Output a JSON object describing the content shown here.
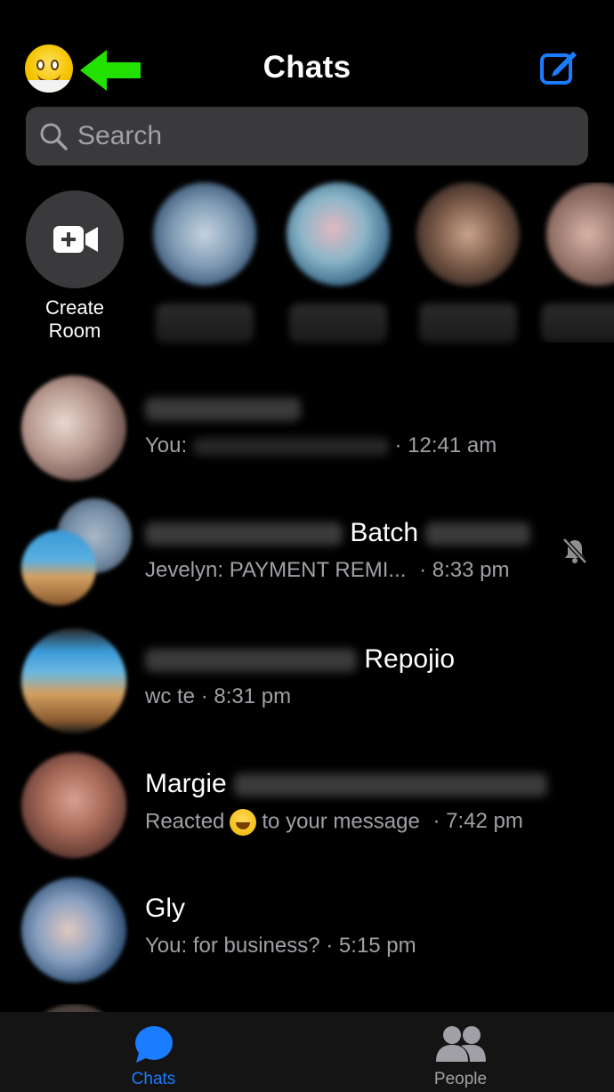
{
  "header": {
    "title": "Chats",
    "arrow_color": "#22e000",
    "accent_color": "#1a7cff"
  },
  "search": {
    "placeholder": "Search"
  },
  "stories": {
    "create_room_label_line1": "Create",
    "create_room_label_line2": "Room"
  },
  "chats": [
    {
      "name": "",
      "preview_prefix": "You:",
      "time": "· 12:41 am",
      "muted": false
    },
    {
      "name": "Batch",
      "preview": "Jevelyn: PAYMENT REMI...",
      "time": "· 8:33 pm",
      "muted": true
    },
    {
      "name": "Repojio",
      "preview": "wc te",
      "time": "· 8:31 pm",
      "muted": false
    },
    {
      "name": "Margie",
      "preview_prefix": "Reacted",
      "preview_suffix": "to your message",
      "time": "· 7:42 pm",
      "muted": false
    },
    {
      "name": "Gly",
      "preview": "You: for business?",
      "time": "· 5:15 pm",
      "muted": false
    }
  ],
  "tabs": {
    "chats": "Chats",
    "people": "People",
    "active_color": "#1a7cff",
    "inactive_color": "#a0a0a6"
  }
}
